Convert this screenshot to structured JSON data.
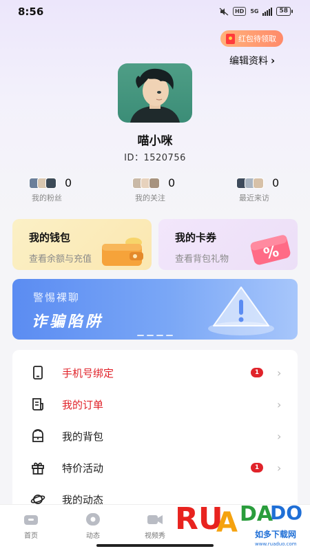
{
  "status_bar": {
    "time": "8:56",
    "hd": "HD",
    "network": "5G",
    "battery": "58"
  },
  "header": {
    "red_packet_label": "红包待领取",
    "edit_profile_label": "编辑资料"
  },
  "profile": {
    "nickname": "喵小咪",
    "id_text": "ID：1520756"
  },
  "stats": [
    {
      "count": "0",
      "label": "我的粉丝"
    },
    {
      "count": "0",
      "label": "我的关注"
    },
    {
      "count": "0",
      "label": "最近来访"
    }
  ],
  "cards": {
    "wallet": {
      "title": "我的钱包",
      "subtitle": "查看余额与充值"
    },
    "coupon": {
      "title": "我的卡券",
      "subtitle": "查看背包礼物"
    }
  },
  "banner": {
    "line1": "警惕裸聊",
    "line2": "诈骗陷阱"
  },
  "menu": [
    {
      "label": "手机号绑定",
      "icon": "phone-icon",
      "badge": "1",
      "highlight": true
    },
    {
      "label": "我的订单",
      "icon": "order-icon",
      "badge": "",
      "highlight": true
    },
    {
      "label": "我的背包",
      "icon": "backpack-icon",
      "badge": "",
      "highlight": false
    },
    {
      "label": "特价活动",
      "icon": "gift-icon",
      "badge": "1",
      "highlight": false
    },
    {
      "label": "我的动态",
      "icon": "planet-icon",
      "badge": "",
      "highlight": false
    }
  ],
  "bottom_nav": [
    {
      "label": "首页",
      "icon": "home-icon"
    },
    {
      "label": "动态",
      "icon": "feed-icon"
    },
    {
      "label": "视频秀",
      "icon": "video-icon"
    }
  ],
  "watermark": {
    "brand": "RUANDADO",
    "tagline": "如多下载网",
    "url": "www.ruaduo.com"
  },
  "colors": {
    "accent_red": "#e0232a",
    "banner_blue": "#5b8cf2",
    "wallet_yellow": "#fbe7b0",
    "coupon_purple": "#ecdff7"
  }
}
